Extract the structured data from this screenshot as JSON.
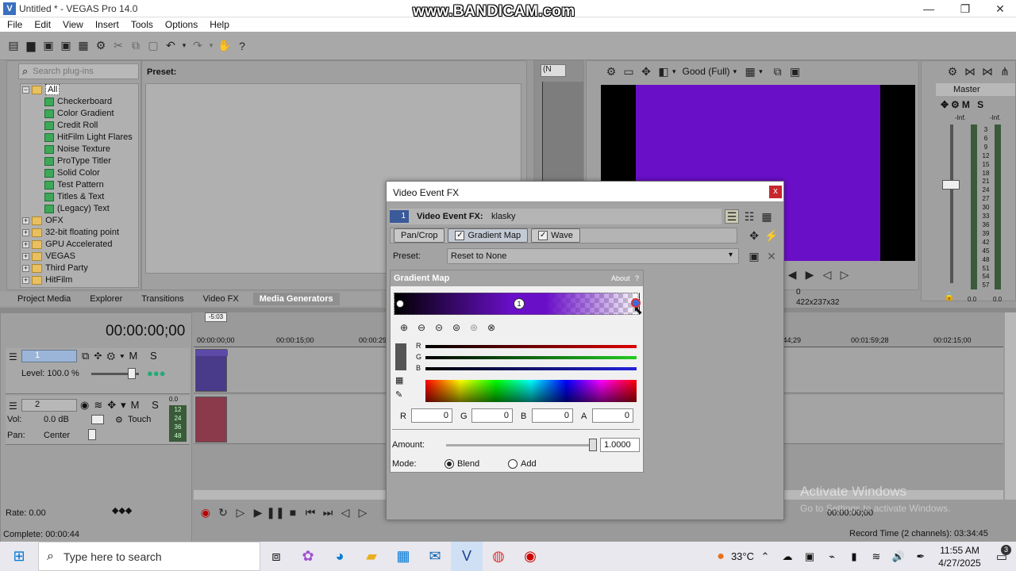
{
  "window": {
    "title": "Untitled * - VEGAS Pro 14.0",
    "app_icon": "V",
    "watermark": "www.BANDICAM.com"
  },
  "menu": [
    "File",
    "Edit",
    "View",
    "Insert",
    "Tools",
    "Options",
    "Help"
  ],
  "plugins": {
    "search_placeholder": "Search plug-ins",
    "preset_label": "Preset:",
    "tree_root": "All",
    "generators": [
      "Checkerboard",
      "Color Gradient",
      "Credit Roll",
      "HitFilm Light Flares",
      "Noise Texture",
      "ProType Titler",
      "Solid Color",
      "Test Pattern",
      "Titles & Text",
      "(Legacy) Text"
    ],
    "folders": [
      "OFX",
      "32-bit floating point",
      "GPU Accelerated",
      "VEGAS",
      "Third Party",
      "HitFilm"
    ]
  },
  "tabs": [
    "Project Media",
    "Explorer",
    "Transitions",
    "Video FX",
    "Media Generators"
  ],
  "active_tab": "Media Generators",
  "trimmer": {
    "dropdown": "(N"
  },
  "preview": {
    "quality": "Good (Full)",
    "frame_value": "0",
    "resolution": "422x237x32",
    "video_color": "#6a0fc8"
  },
  "master": {
    "label": "Master",
    "left_level": "-Inf.",
    "right_level": "-Inf.",
    "scale": [
      "3",
      "6",
      "9",
      "12",
      "15",
      "18",
      "21",
      "24",
      "27",
      "30",
      "33",
      "36",
      "39",
      "42",
      "45",
      "48",
      "51",
      "54",
      "57"
    ],
    "bottom_left": "0.0",
    "bottom_right": "0.0"
  },
  "timeline": {
    "timecode": "00:00:00;00",
    "marker": "-5:03",
    "ruler": [
      "00:00:00;00",
      "00:00:15;00",
      "00:00:29",
      ":44;29",
      "00:01:59;28",
      "00:02:15;00"
    ],
    "track1": {
      "num": "1",
      "level": "Level: 100.0 %"
    },
    "track2": {
      "num": "2",
      "vol": "Vol:",
      "vol_value": "0.0 dB",
      "touch": "Touch",
      "pan": "Pan:",
      "pan_value": "Center",
      "meter": [
        "12",
        "24",
        "36",
        "48"
      ],
      "meter_top": "0.0"
    },
    "rate": "Rate: 0.00",
    "bottom_timecode": "00:00:00;00",
    "record_time": "Record Time (2 channels): 03:34:45",
    "status": "Complete: 00:00:44"
  },
  "dialog": {
    "title": "Video Event FX",
    "close": "x",
    "event_num": "1",
    "header_label": "Video Event FX:",
    "header_name": "klasky",
    "chain": [
      "Pan/Crop",
      "Gradient Map",
      "Wave"
    ],
    "preset_label": "Preset:",
    "preset_value": "Reset to None",
    "panel_title": "Gradient Map",
    "about": "About",
    "help": "?",
    "gradient_marker": "1",
    "channels": [
      "R",
      "G",
      "B"
    ],
    "r_label": "R",
    "r_value": "0",
    "g_label": "G",
    "g_value": "0",
    "b_label": "B",
    "b_value": "0",
    "a_label": "A",
    "a_value": "0",
    "amount_label": "Amount:",
    "amount_value": "1.0000",
    "mode_label": "Mode:",
    "mode_blend": "Blend",
    "mode_add": "Add",
    "mode_selected": "Blend"
  },
  "activate": {
    "title": "Activate Windows",
    "sub": "Go to Settings to activate Windows."
  },
  "taskbar": {
    "search_placeholder": "Type here to search",
    "temperature": "33°C",
    "time": "11:55 AM",
    "date": "4/27/2025",
    "notification_count": "3"
  },
  "colors": {
    "accent_purple": "#6a0fc8",
    "dark_bg": "#2a2a2a"
  }
}
